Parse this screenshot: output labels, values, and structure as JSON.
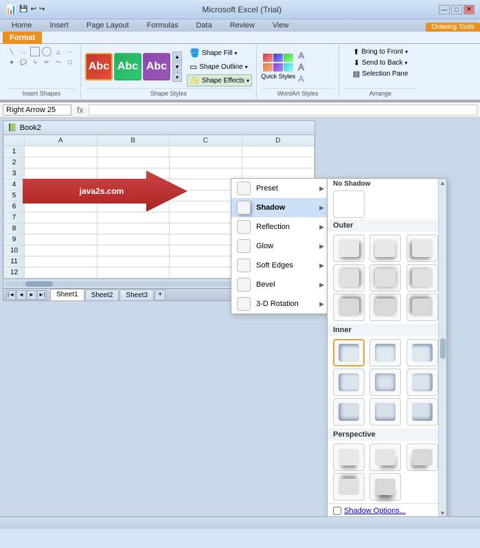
{
  "titlebar": {
    "title": "Microsoft Excel (Trial)",
    "drawing_tools_label": "Drawing Tools",
    "min_btn": "—",
    "max_btn": "□",
    "close_btn": "✕"
  },
  "ribbon": {
    "tabs": [
      "Home",
      "Insert",
      "Page Layout",
      "Formulas",
      "Data",
      "Review",
      "View"
    ],
    "active_tab": "Format",
    "drawing_tools_tab": "Drawing Tools",
    "format_tab": "Format",
    "groups": {
      "insert_shapes": "Insert Shapes",
      "shape_styles": "Shape Styles",
      "arrange": "Arrange",
      "wordart_styles": "WordArt Styles"
    },
    "buttons": {
      "shape_fill": "Shape Fill",
      "shape_outline": "Shape Outline",
      "shape_effects": "Shape Effects",
      "bring_to_front": "Bring to Front",
      "send_to_back": "Send to Back",
      "selection_pane": "Selection Pane",
      "quick_styles": "Quick Styles"
    },
    "abc_styles": [
      "Abc",
      "Abc",
      "Abc"
    ]
  },
  "formula_bar": {
    "name_box": "Right Arrow 25",
    "fx": "fx"
  },
  "spreadsheet": {
    "title": "Book2",
    "columns": [
      "",
      "A",
      "B",
      "C",
      "D"
    ],
    "rows": [
      "1",
      "2",
      "3",
      "4",
      "5",
      "6",
      "7",
      "8",
      "9",
      "10",
      "11",
      "12"
    ],
    "arrow_text": "java2s.com",
    "sheet_tabs": [
      "Sheet1",
      "Sheet2",
      "Sheet3"
    ]
  },
  "dropdown_menu": {
    "items": [
      {
        "label": "Preset",
        "has_arrow": true
      },
      {
        "label": "Shadow",
        "has_arrow": true,
        "active": true
      },
      {
        "label": "Reflection",
        "has_arrow": true
      },
      {
        "label": "Glow",
        "has_arrow": true
      },
      {
        "label": "Soft Edges",
        "has_arrow": true
      },
      {
        "label": "Bevel",
        "has_arrow": true
      },
      {
        "label": "3-D Rotation",
        "has_arrow": true
      }
    ]
  },
  "shadow_panel": {
    "no_shadow_label": "No Shadow",
    "outer_label": "Outer",
    "inner_label": "Inner",
    "perspective_label": "Perspective",
    "footer": "Shadow Options...",
    "selected_index": 9
  },
  "statusbar": {
    "text": ""
  }
}
